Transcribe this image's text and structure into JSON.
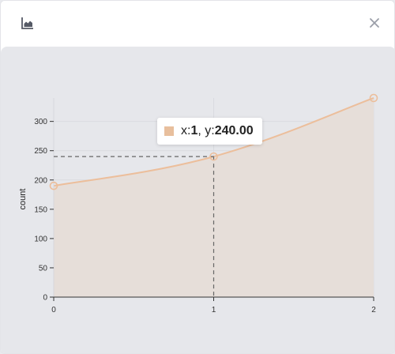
{
  "window": {
    "chart_icon": "area-chart-icon",
    "close_icon": "close-icon"
  },
  "colors": {
    "series": "#ecbe9b",
    "area_fill": "#e6ded9",
    "grid": "#dadbe0",
    "crosshair": "#666666"
  },
  "tooltip": {
    "x_prefix": "x: ",
    "x_value": "1",
    "y_prefix": ", y: ",
    "y_value": "240.00"
  },
  "chart_data": {
    "type": "area",
    "x": [
      0,
      1,
      2
    ],
    "xticks": [
      "0",
      "1",
      "2"
    ],
    "series": [
      {
        "values": [
          190,
          240,
          340
        ]
      }
    ],
    "ylabel": "count",
    "xlabel": "",
    "ylim": [
      0,
      340
    ],
    "yticks": [
      0,
      50,
      100,
      150,
      200,
      250,
      300
    ],
    "grid": true,
    "highlight": {
      "x": 1,
      "y": 240
    }
  }
}
